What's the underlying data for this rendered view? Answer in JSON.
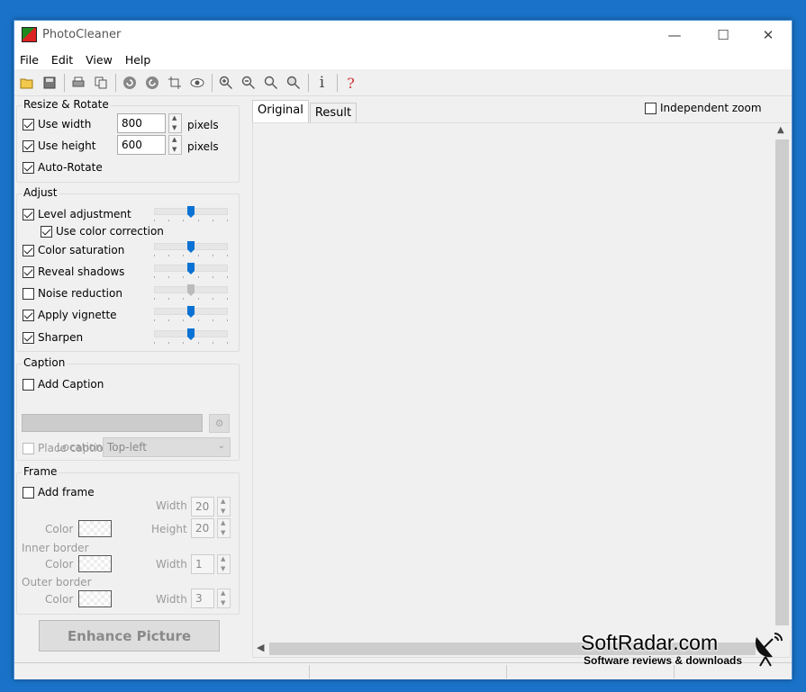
{
  "window": {
    "title": "PhotoCleaner"
  },
  "window_controls": {
    "minimize": "—",
    "maximize": "☐",
    "close": "✕"
  },
  "menu": [
    "File",
    "Edit",
    "View",
    "Help"
  ],
  "toolbar_icons": [
    "open-folder-icon",
    "save-icon",
    "print-icon",
    "copy-icon",
    "rotate-left-icon",
    "rotate-right-icon",
    "crop-icon",
    "eye-icon",
    "zoom-in-icon",
    "zoom-out-icon",
    "zoom-fit-icon",
    "zoom-actual-icon",
    "info-icon",
    "help-icon"
  ],
  "toolbar_glyphs": {
    "info": "i",
    "help": "?"
  },
  "resize": {
    "title": "Resize & Rotate",
    "use_width": {
      "label": "Use width",
      "checked": true,
      "value": "800",
      "unit": "pixels"
    },
    "use_height": {
      "label": "Use height",
      "checked": true,
      "value": "600",
      "unit": "pixels"
    },
    "auto_rotate": {
      "label": "Auto-Rotate",
      "checked": true
    }
  },
  "adjust": {
    "title": "Adjust",
    "level_adjustment": {
      "label": "Level adjustment",
      "checked": true,
      "level": 0.5
    },
    "use_color_correction": {
      "label": "Use color correction",
      "checked": true
    },
    "color_saturation": {
      "label": "Color saturation",
      "checked": true,
      "level": 0.5
    },
    "reveal_shadows": {
      "label": "Reveal shadows",
      "checked": true,
      "level": 0.5
    },
    "noise_reduction": {
      "label": "Noise reduction",
      "checked": false,
      "level": 0.5
    },
    "apply_vignette": {
      "label": "Apply vignette",
      "checked": true,
      "level": 0.5
    },
    "sharpen": {
      "label": "Sharpen",
      "checked": true,
      "level": 0.5
    }
  },
  "caption": {
    "title": "Caption",
    "add_caption": {
      "label": "Add Caption",
      "checked": false
    },
    "location_label": "Location",
    "location_value": "Top-left",
    "place_on_frame": {
      "label": "Place caption on frame",
      "checked": false
    }
  },
  "frame": {
    "title": "Frame",
    "add_frame": {
      "label": "Add frame",
      "checked": false
    },
    "color_label": "Color",
    "width_label": "Width",
    "height_label": "Height",
    "frame_width": "20",
    "frame_height": "20",
    "inner_border_label": "Inner border",
    "inner_width": "1",
    "outer_border_label": "Outer border",
    "outer_width": "3"
  },
  "enhance_button": "Enhance Picture",
  "tabs": [
    "Original",
    "Result"
  ],
  "independent_zoom": {
    "label": "Independent zoom",
    "checked": false
  },
  "watermark": {
    "main": "SoftRadar.com",
    "sub": "Software reviews & downloads"
  },
  "colors": {
    "accent": "#0a72d4",
    "desktop": "#1a73c9",
    "window_bg": "#f0f0f0"
  }
}
